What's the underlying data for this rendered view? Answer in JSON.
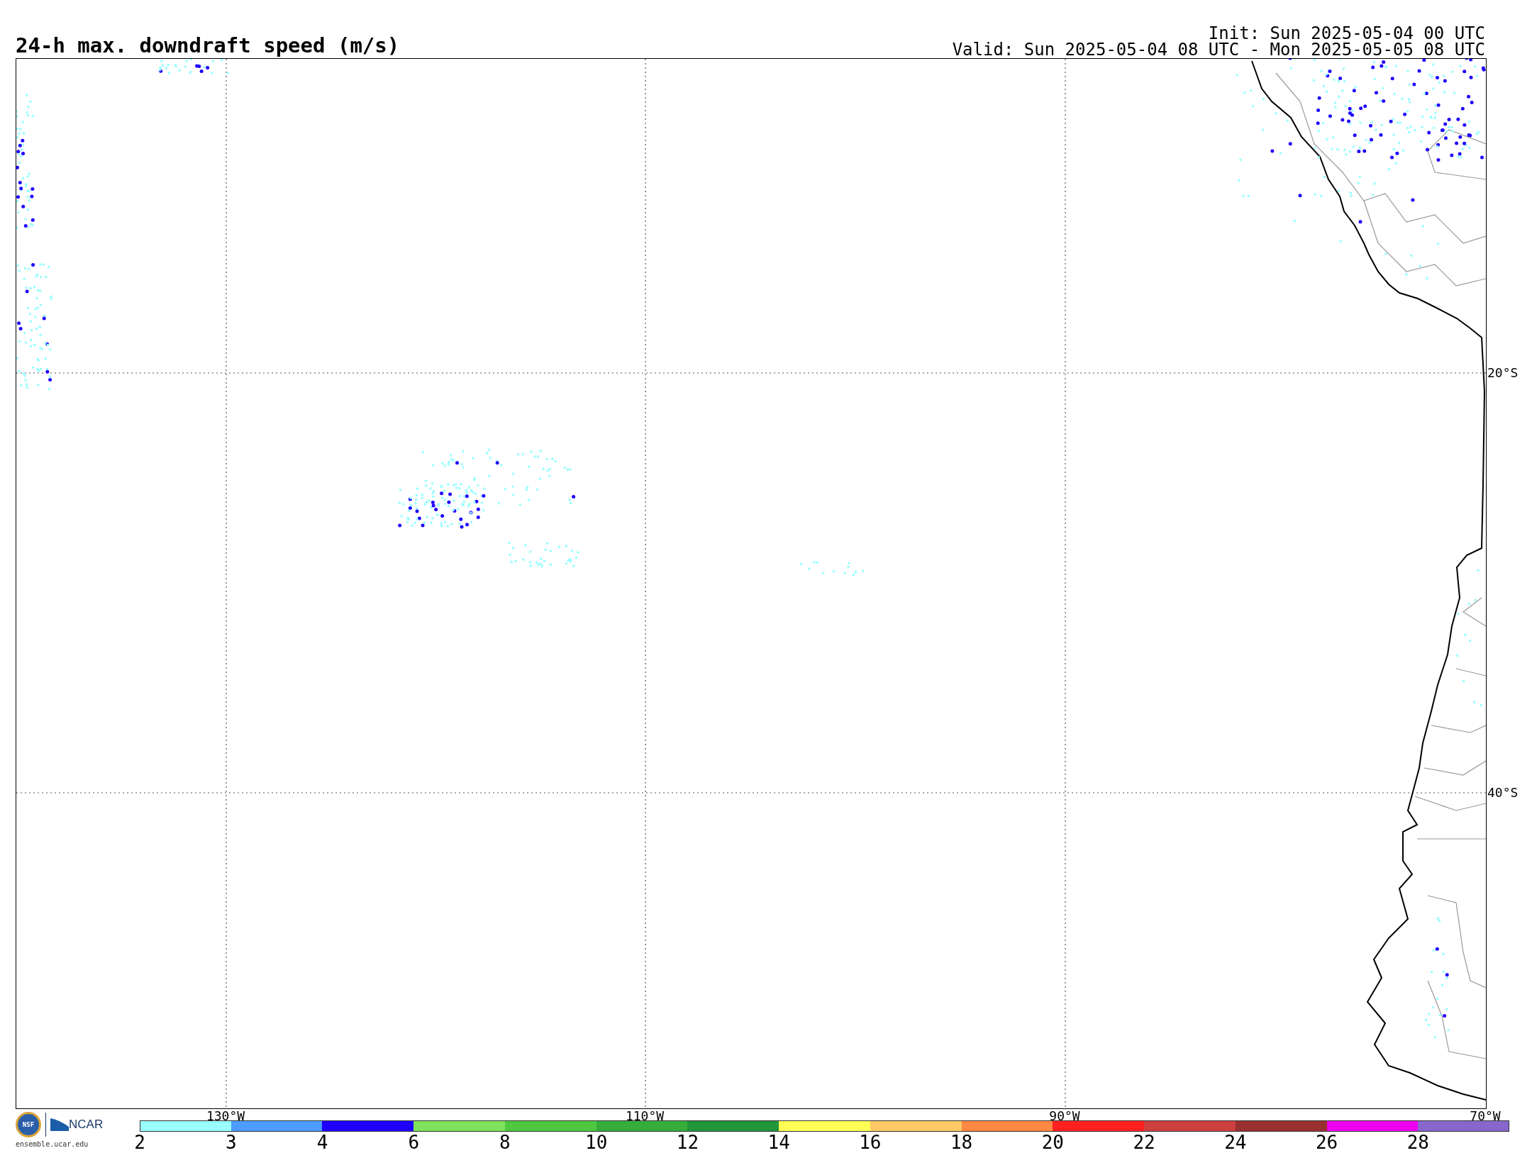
{
  "title": "24-h max. downdraft speed (m/s)",
  "init": "Init: Sun 2025-05-04 00 UTC",
  "valid": "Valid: Sun 2025-05-04 08 UTC - Mon 2025-05-05 08 UTC",
  "map": {
    "lat_labels": [
      "20°S",
      "40°S"
    ],
    "lon_labels": [
      "130°W",
      "110°W",
      "90°W",
      "70°W"
    ]
  },
  "branding": {
    "seal_text": "NSF",
    "org": "NCAR",
    "site": "ensemble.ucar.edu"
  },
  "colorbar": [
    {
      "color": "#99ffff",
      "label": "2"
    },
    {
      "color": "#4d9cff",
      "label": "3"
    },
    {
      "color": "#1f00ff",
      "label": "4"
    },
    {
      "color": "#7ee35a",
      "label": "6"
    },
    {
      "color": "#4fc840",
      "label": "8"
    },
    {
      "color": "#35ad3a",
      "label": "10"
    },
    {
      "color": "#22963a",
      "label": "12"
    },
    {
      "color": "#ffff55",
      "label": "14"
    },
    {
      "color": "#ffca66",
      "label": "16"
    },
    {
      "color": "#ff8844",
      "label": "18"
    },
    {
      "color": "#ff2020",
      "label": "20"
    },
    {
      "color": "#cc4040",
      "label": "22"
    },
    {
      "color": "#993030",
      "label": "24"
    },
    {
      "color": "#ee00ee",
      "label": "26"
    },
    {
      "color": "#8866cc",
      "label": "28"
    }
  ]
}
